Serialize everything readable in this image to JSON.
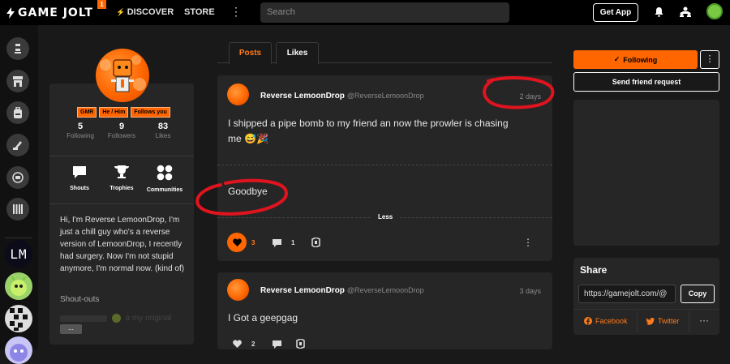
{
  "topbar": {
    "logo_text": "GAME JOLT",
    "logo_badge": "1",
    "discover_label": "DISCOVER",
    "store_label": "STORE",
    "search_placeholder": "Search",
    "get_app_label": "Get App",
    "icons": [
      "bell-icon",
      "friends-icon",
      "user-avatar"
    ]
  },
  "leftbar": {
    "items": [
      "game-jolt-home-icon",
      "store-icon",
      "backpack-icon",
      "quests-icon",
      "chat-icon",
      "library-icon"
    ],
    "game_tiles": [
      "LM",
      "green-creature",
      "pixel-maze",
      "blue-creature"
    ]
  },
  "profile": {
    "tags": [
      "GMR",
      "He / Him",
      "Follows you"
    ],
    "stats": [
      {
        "value": "5",
        "label": "Following"
      },
      {
        "value": "9",
        "label": "Followers"
      },
      {
        "value": "83",
        "label": "Likes"
      }
    ],
    "actions": [
      {
        "label": "Shouts",
        "icon": "shouts-icon"
      },
      {
        "label": "Trophies",
        "icon": "trophy-icon"
      },
      {
        "label": "Communities",
        "icon": "communities-icon"
      }
    ],
    "bio": "Hi, I'm Reverse LemoonDrop, I'm just a chill guy who's a reverse version of LemoonDrop, I recently had surgery. Now I'm not stupid anymore, I'm normal now. (kind of)",
    "shoutouts_label": "Shout-outs",
    "shoutout_faded": "a my original",
    "more_label": "..."
  },
  "tabs": [
    {
      "label": "Posts",
      "active": true
    },
    {
      "label": "Likes",
      "active": false
    }
  ],
  "posts": [
    {
      "author": "Reverse LemoonDrop",
      "handle": "@ReverseLemoonDrop",
      "time": "2 days",
      "text_line1": "I shipped a pipe bomb to my friend an now the prowler is chasing",
      "text_line2": "me 😅🎉",
      "extra_text": "Goodbye",
      "less_label": "Less",
      "likes": "3",
      "comments": "1",
      "liked": true
    },
    {
      "author": "Reverse LemoonDrop",
      "handle": "@ReverseLemoonDrop",
      "time": "3 days",
      "text_line1": "I Got a geepgag",
      "likes": "2",
      "comments": "",
      "liked": false
    }
  ],
  "sidebar_right": {
    "following_label": "Following",
    "friend_request_label": "Send friend request",
    "share_title": "Share",
    "share_url": "https://gamejolt.com/@",
    "copy_label": "Copy",
    "facebook_label": "Facebook",
    "twitter_label": "Twitter"
  },
  "colors": {
    "accent": "#ff6600",
    "annotation": "#e0141e",
    "background": "#191919",
    "panel": "#262626"
  }
}
